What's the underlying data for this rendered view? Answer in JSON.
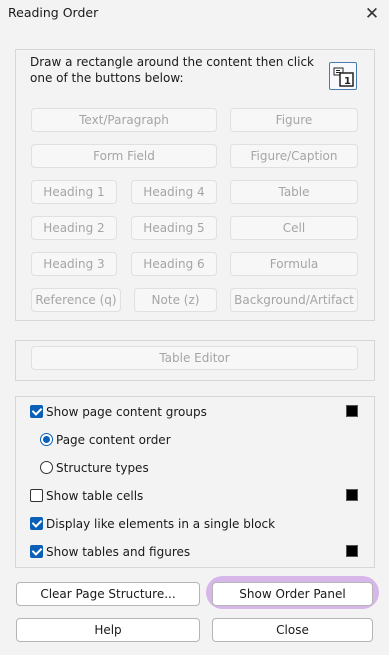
{
  "window": {
    "title": "Reading Order",
    "close_glyph": "✕"
  },
  "instructions": "Draw a rectangle around the content then click one of the buttons below:",
  "tag_buttons": {
    "text_paragraph": "Text/Paragraph",
    "figure": "Figure",
    "form_field": "Form Field",
    "figure_caption": "Figure/Caption",
    "heading1": "Heading 1",
    "heading4": "Heading 4",
    "table": "Table",
    "heading2": "Heading 2",
    "heading5": "Heading 5",
    "cell": "Cell",
    "heading3": "Heading 3",
    "heading6": "Heading 6",
    "formula": "Formula",
    "reference": "Reference (q)",
    "note": "Note (z)",
    "background": "Background/Artifact"
  },
  "table_editor": "Table Editor",
  "options": {
    "show_page_content_groups": {
      "label": "Show page content groups",
      "checked": true
    },
    "page_content_order": {
      "label": "Page content order",
      "selected": true
    },
    "structure_types": {
      "label": "Structure types",
      "selected": false
    },
    "show_table_cells": {
      "label": "Show table cells",
      "checked": false
    },
    "display_like_elements": {
      "label": "Display like elements in a single block",
      "checked": true
    },
    "show_tables_figures": {
      "label": "Show tables and figures",
      "checked": true
    }
  },
  "swatch_color": "#000000",
  "buttons": {
    "clear_page_structure": "Clear Page Structure...",
    "show_order_panel": "Show Order Panel",
    "help": "Help",
    "close": "Close"
  },
  "highlight_color": "#d7b7ea"
}
